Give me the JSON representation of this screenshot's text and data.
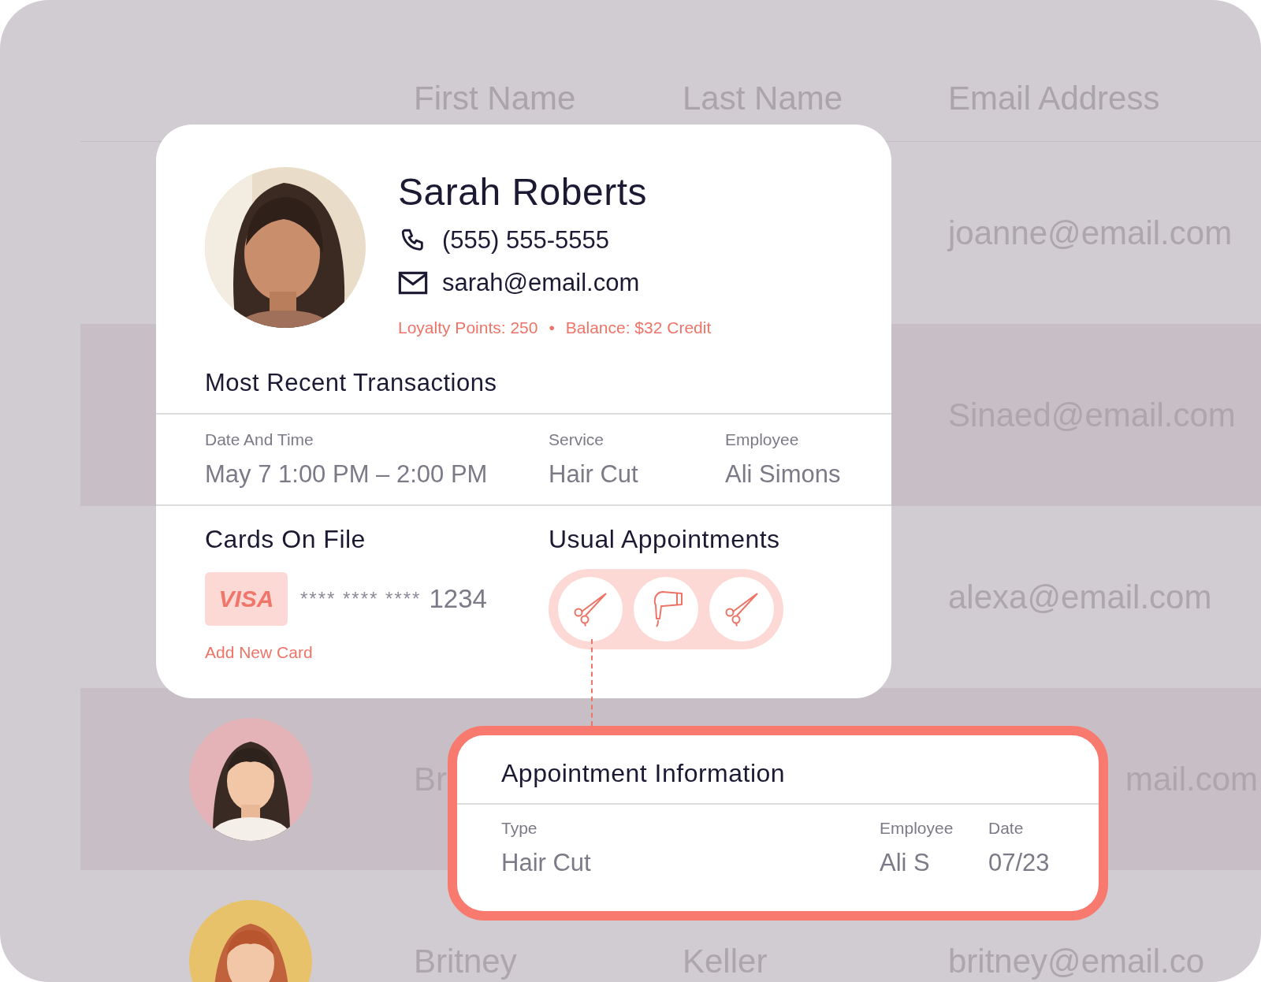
{
  "table": {
    "columns": [
      "First Name",
      "Last Name",
      "Email Address"
    ],
    "rows": [
      {
        "shaded": false,
        "partly_hidden": false,
        "email": "joanne@email.com"
      },
      {
        "shaded": true,
        "partly_hidden": false,
        "email": "Sinaed@email.com"
      },
      {
        "shaded": false,
        "partly_hidden": false,
        "email": "alexa@email.com"
      },
      {
        "shaded": true,
        "avatar": true,
        "partly_hidden": true,
        "first_name": "Br",
        "email": "mail.com"
      },
      {
        "shaded": false,
        "avatar": true,
        "partly_hidden": false,
        "first_name": "Britney",
        "last_name": "Keller",
        "email": "britney@email.co"
      }
    ]
  },
  "profile": {
    "name": "Sarah Roberts",
    "phone": "(555) 555-5555",
    "email": "sarah@email.com",
    "loyalty": "Loyalty Points: 250",
    "separator": "•",
    "balance": "Balance: $32 Credit"
  },
  "transactions": {
    "title": "Most Recent Transactions",
    "columns": [
      "Date And Time",
      "Service",
      "Employee"
    ],
    "rows": [
      [
        "May 7 1:00 PM – 2:00 PM",
        "Hair Cut",
        "Ali Simons"
      ]
    ]
  },
  "cards": {
    "title": "Cards On File",
    "items": [
      {
        "brand": "VISA",
        "masked": "**** **** ****",
        "last4": "1234"
      }
    ],
    "add_link": "Add New Card"
  },
  "usual": {
    "title": "Usual Appointments",
    "services": [
      {
        "kind": "scissors"
      },
      {
        "kind": "dryer"
      },
      {
        "kind": "scissors"
      }
    ]
  },
  "appointment": {
    "title": "Appointment Information",
    "columns": [
      "Type",
      "Employee",
      "Date"
    ],
    "values": [
      "Hair Cut",
      "Ali S",
      "07/23"
    ]
  }
}
